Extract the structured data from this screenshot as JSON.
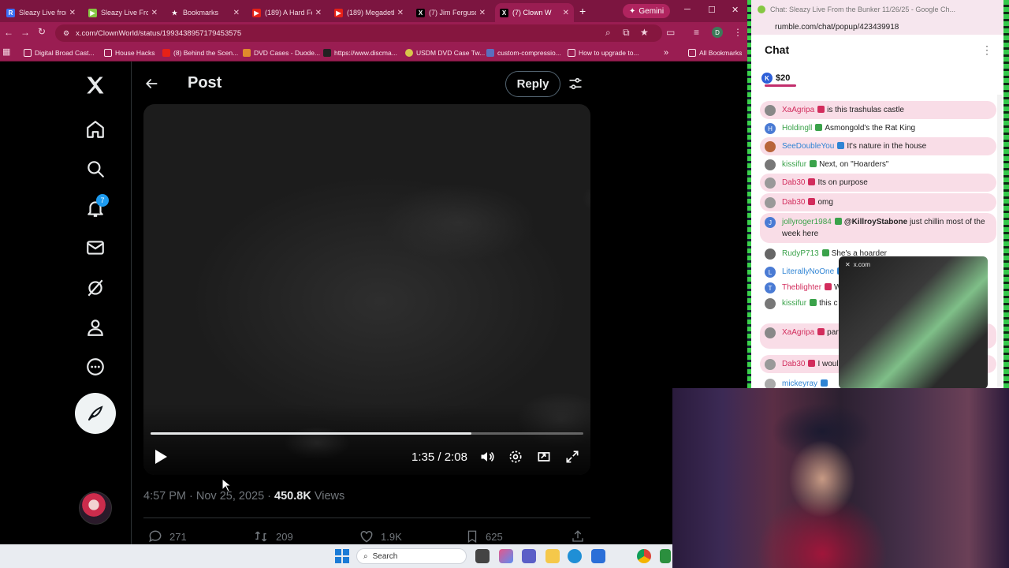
{
  "browser": {
    "tabs": [
      {
        "label": "Sleazy Live from",
        "fav": "R",
        "color": "#3b6ff5"
      },
      {
        "label": "Sleazy Live From",
        "fav": "▶",
        "color": "#85c742"
      },
      {
        "label": "Bookmarks",
        "fav": "★",
        "color": "#9a1d52"
      },
      {
        "label": "(189) A Hard Fo",
        "fav": "▶",
        "color": "#e62117"
      },
      {
        "label": "(189) Megadeth",
        "fav": "▶",
        "color": "#e62117"
      },
      {
        "label": "(7) Jim Ferguson",
        "fav": "X",
        "color": "#000000"
      },
      {
        "label": "(7) Clown W",
        "fav": "X",
        "color": "#000000"
      }
    ],
    "gemini_label": "Gemini",
    "url": "x.com/ClownWorld/status/1993438957179453575",
    "profile_initial": "D",
    "bookmarks": [
      "Digital Broad Cast...",
      "House Hacks",
      "(8) Behind the Scen...",
      "DVD Cases - Duode...",
      "https://www.discma...",
      "USDM DVD Case Tw...",
      "custom-compressio...",
      "How to upgrade to..."
    ],
    "all_bookmarks_label": "All Bookmarks",
    "more_bookmarks_label": "»"
  },
  "x_nav": {
    "notification_count": "7"
  },
  "post": {
    "header_title": "Post",
    "reply_label": "Reply",
    "video": {
      "current_time": "1:35",
      "duration": "2:08",
      "time_separator": " / ",
      "progress_fraction": 0.742
    },
    "meta_time": "4:57 PM · Nov 25, 2025 · ",
    "views_count": "450.8K",
    "views_label": " Views",
    "actions": {
      "replies": "271",
      "reposts": "209",
      "likes": "1.9K",
      "bookmarks": "625"
    }
  },
  "taskbar": {
    "search_label": "Search"
  },
  "chat": {
    "window_title": "Chat: Sleazy Live From the Bunker 11/26/25 - Google Ch...",
    "url": "rumble.com/chat/popup/423439918",
    "heading": "Chat",
    "tip_amount": "$20",
    "messages": [
      {
        "user": "XaAgripa",
        "text": "is this trashulas castle",
        "user_color": "#d22c5c",
        "av": "",
        "av_color": "#888888",
        "pink": true
      },
      {
        "user": "Holdingll",
        "text": "Asmongold's the Rat King",
        "user_color": "#3aa24a",
        "av": "H",
        "av_color": "#4a7bd4",
        "pink": false
      },
      {
        "user": "SeeDoubleYou",
        "text": "It's nature in the house",
        "user_color": "#2f84d4",
        "av": "",
        "av_color": "#b8653a",
        "pink": true
      },
      {
        "user": "kissifur",
        "text": "Next, on \"Hoarders\"",
        "user_color": "#3aa24a",
        "av": "",
        "av_color": "#777777",
        "pink": false
      },
      {
        "user": "Dab30",
        "text": "Its on purpose",
        "user_color": "#d22c5c",
        "av": "",
        "av_color": "#999999",
        "pink": true
      },
      {
        "user": "Dab30",
        "text": "omg",
        "user_color": "#d22c5c",
        "av": "",
        "av_color": "#999999",
        "pink": true
      },
      {
        "user": "jollyroger1984",
        "mention": "@KillroyStabone",
        "text": "just chillin most of the week here",
        "user_color": "#3aa24a",
        "av": "J",
        "av_color": "#4a7bd4",
        "pink": true
      },
      {
        "user": "RudyP713",
        "text": "She's a hoarder",
        "user_color": "#3aa24a",
        "av": "",
        "av_color": "#666666",
        "pink": false
      },
      {
        "user": "LiterallyNoOne",
        "text": "",
        "user_color": "#2f84d4",
        "av": "L",
        "av_color": "#4a7bd4",
        "pink": false
      },
      {
        "user": "Theblighter",
        "text": "Will",
        "user_color": "#d22c5c",
        "av": "T",
        "av_color": "#4a7bd4",
        "pink": false
      },
      {
        "user": "kissifur",
        "text": "this c doesn't phase hi",
        "user_color": "#3aa24a",
        "av": "",
        "av_color": "#777777",
        "pink": false
      },
      {
        "user": "XaAgripa",
        "text": "party animals",
        "user_color": "#d22c5c",
        "av": "",
        "av_color": "#888888",
        "pink": true
      },
      {
        "user": "Dab30",
        "text": "I woul",
        "user_color": "#d22c5c",
        "av": "",
        "av_color": "#999999",
        "pink": true
      },
      {
        "user": "mickeyray",
        "text": "",
        "user_color": "#2f84d4",
        "av": "",
        "av_color": "#aaaaaa",
        "pink": false
      }
    ],
    "pip_label": "x.com"
  }
}
